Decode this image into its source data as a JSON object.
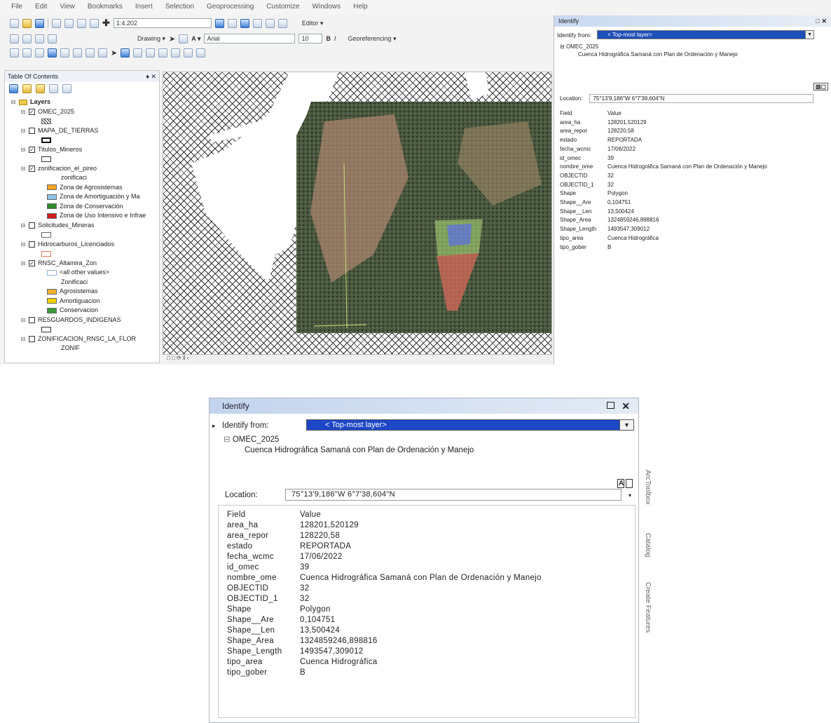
{
  "menu": [
    "File",
    "Edit",
    "View",
    "Bookmarks",
    "Insert",
    "Selection",
    "Geoprocessing",
    "Customize",
    "Windows",
    "Help"
  ],
  "toolbar": {
    "scale": "1:4.202",
    "editor_label": "Editor ▾",
    "drawing_label": "Drawing ▾",
    "font_name": "Arial",
    "font_size": "10",
    "bold": "B",
    "italic": "I",
    "georeferencing_label": "Georeferencing ▾"
  },
  "toc": {
    "title": "Table Of Contents",
    "pin": "♦ ✕",
    "root": "Layers",
    "layers": [
      {
        "name": "OMEC_2025",
        "checked": true
      },
      {
        "name": "MAPA_DE_TIERRAS",
        "checked": false
      },
      {
        "name": "Titulos_Mineros",
        "checked": true
      },
      {
        "name": "zonificacion_el_pireo",
        "checked": true,
        "sub": "zonificaci"
      },
      {
        "name": "Solicitudes_Mineras",
        "checked": false
      },
      {
        "name": "Hidrocarburos_Licenciados",
        "checked": false
      },
      {
        "name": "RNSC_Altamira_Zon",
        "checked": true,
        "sub": "Zonificaci"
      },
      {
        "name": "RESGUARDOS_INDIGENAS",
        "checked": false
      },
      {
        "name": "ZONIFICACION_RNSC_LA_FLOR",
        "checked": false,
        "sub": "ZONIF"
      }
    ],
    "legend_pireo": [
      {
        "label": "Zona de Agrosistemas",
        "color": "#f5a623"
      },
      {
        "label": "Zona de Amortiguación y Ma",
        "color": "#8fc3ea"
      },
      {
        "label": "Zona de Conservación",
        "color": "#2e8b2e"
      },
      {
        "label": "Zona de Uso Intensivo e Infrae",
        "color": "#d01f1f"
      }
    ],
    "legend_altamira": [
      {
        "label": "<all other values>",
        "color": "#ffffff"
      },
      {
        "label": "Agrosistemas",
        "color": "#f0b030"
      },
      {
        "label": "Amortiguacion",
        "color": "#f2d200"
      },
      {
        "label": "Conservacion",
        "color": "#3a9a3a"
      }
    ]
  },
  "map_status": "□ □  ⟳ ‖  ‹",
  "identify": {
    "title": "Identify",
    "identify_from_label": "Identify from:",
    "identify_from_value": "< Top-most layer>",
    "tree_layer": "OMEC_2025",
    "tree_feature": "Cuenca Hidrográfica Samaná con Plan de Ordenación y Manejo",
    "location_label": "Location:",
    "location_value": "75°13'9,186\"W  6°7'38,604\"N",
    "col_field": "Field",
    "col_value": "Value",
    "rows": [
      {
        "field": "area_ha",
        "value": "128201,520129"
      },
      {
        "field": "area_repor",
        "value": "128220,58"
      },
      {
        "field": "estado",
        "value": "REPORTADA"
      },
      {
        "field": "fecha_wcmc",
        "value": "17/06/2022"
      },
      {
        "field": "id_omec",
        "value": "39"
      },
      {
        "field": "nombre_ome",
        "value": "Cuenca Hidrográfica Samaná con Plan de Ordenación y Manejo"
      },
      {
        "field": "OBJECTID",
        "value": "32"
      },
      {
        "field": "OBJECTID_1",
        "value": "32"
      },
      {
        "field": "Shape",
        "value": "Polygon"
      },
      {
        "field": "Shape__Are",
        "value": "0,104751"
      },
      {
        "field": "Shape__Len",
        "value": "13,500424"
      },
      {
        "field": "Shape_Area",
        "value": "1324859246,898816"
      },
      {
        "field": "Shape_Length",
        "value": "1493547,309012"
      },
      {
        "field": "tipo_area",
        "value": "Cuenca Hidrográfica"
      },
      {
        "field": "tipo_gober",
        "value": "B"
      }
    ]
  },
  "side_tabs": [
    "ArcToolbox",
    "Catalog",
    "Create Features"
  ]
}
